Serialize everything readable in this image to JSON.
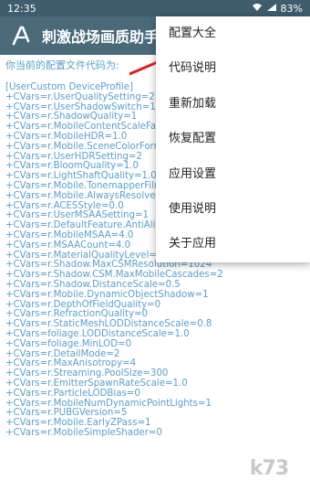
{
  "statusbar": {
    "time": "12:35",
    "battery": "83%"
  },
  "appbar": {
    "title": "刺激战场画质助手"
  },
  "content": {
    "hint": "你当前的配置文件代码为:",
    "lines": [
      "[UserCustom DeviceProfile]",
      "+CVars=r.UserQualitySetting=2",
      "+CVars=r.UserShadowSwitch=1",
      "+CVars=r.ShadowQuality=1",
      "+CVars=r.MobileContentScaleFacto",
      "+CVars=r.MobileHDR=1.0",
      "+CVars=r.Mobile.SceneColorForma",
      "+CVars=r.UserHDRSetting=2",
      "+CVars=r.BloomQuality=1.0",
      "+CVars=r.LightShaftQuality=1.0",
      "+CVars=r.Mobile.TonemapperFilm=",
      "+CVars=r.Mobile.AlwaysResolveDe",
      "+CVars=r.ACESStyle=0.0",
      "+CVars=r.UserMSAASetting=1",
      "+CVars=r.DefaultFeature.AntiAliasin",
      "+CVars=r.MobileMSAA=4.0",
      "+CVars=r.MSAACount=4.0",
      "+CVars=r.MaterialQualityLevel=1",
      "+CVars=r.Shadow.MaxCSMResolution=1024",
      "+CVars=r.Shadow.CSM.MaxMobileCascades=2",
      "+CVars=r.Shadow.DistanceScale=0.5",
      "+CVars=r.Mobile.DynamicObjectShadow=1",
      "+CVars=r.DepthOfFieldQuality=0",
      "+CVars=r.RefractionQuality=0",
      "+CVars=r.StaticMeshLODDistanceScale=0.8",
      "+CVars=foliage.LODDistanceScale=1.0",
      "+CVars=foliage.MinLOD=0",
      "+CVars=r.DetailMode=2",
      "+CVars=r.MaxAnisotropy=4",
      "+CVars=r.Streaming.PoolSize=300",
      "+CVars=r.EmitterSpawnRateScale=1.0",
      "+CVars=r.ParticleLODBias=0",
      "+CVars=r.MobileNumDynamicPointLights=1",
      "+CVars=r.PUBGVersion=5",
      "+CVars=r.Mobile.EarlyZPass=1",
      "+CVars=r.MobileSimpleShader=0"
    ]
  },
  "menu": {
    "items": [
      "配置大全",
      "代码说明",
      "重新加载",
      "恢复配置",
      "应用设置",
      "使用说明",
      "关于应用"
    ]
  },
  "watermark": {
    "text": "k73"
  },
  "colors": {
    "appbar": "#4a6a79",
    "statusbar": "#3e5d6d",
    "code_text": "#5aa0c8",
    "arrow": "#e02020"
  },
  "icons": {
    "logo": "app-logo-icon",
    "arrow": "red-arrow-icon"
  }
}
